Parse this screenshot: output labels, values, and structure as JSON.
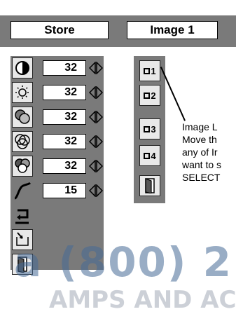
{
  "header": {
    "store_label": "Store",
    "image_label": "Image 1"
  },
  "adjustments": [
    {
      "icon": "contrast-icon",
      "value": "32"
    },
    {
      "icon": "brightness-icon",
      "value": "32"
    },
    {
      "icon": "color-icon",
      "value": "32"
    },
    {
      "icon": "tint-icon",
      "value": "32"
    },
    {
      "icon": "white-balance-icon",
      "value": "32"
    },
    {
      "icon": "gamma-curve-icon",
      "value": "15"
    }
  ],
  "extra_icons": [
    "reset-icon",
    "store-icon",
    "quit-icon"
  ],
  "image_memories": [
    {
      "label": "1"
    },
    {
      "label": "2"
    },
    {
      "label": "3"
    },
    {
      "label": "4"
    },
    {
      "label": ""
    }
  ],
  "callout": {
    "line1": "Image L",
    "line2": "Move th",
    "line3": "any of Ir",
    "line4": "want to s",
    "line5": "SELECT"
  },
  "watermark": {
    "line1": "a (800) 2",
    "line2": "AMPS AND ACC"
  }
}
